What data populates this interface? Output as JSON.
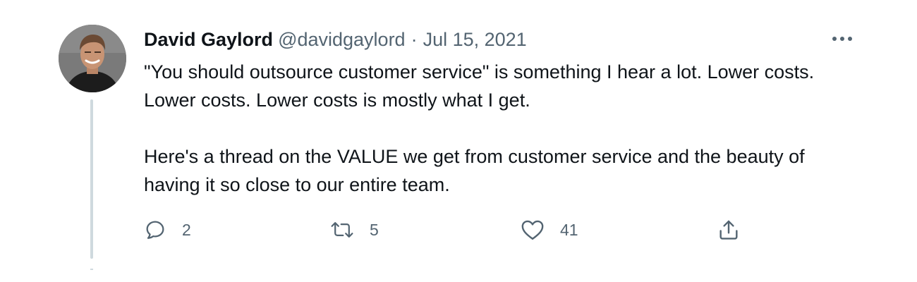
{
  "tweet": {
    "author_name": "David Gaylord",
    "author_handle": "@davidgaylord",
    "separator": "·",
    "timestamp": "Jul 15, 2021",
    "paragraphs": [
      "\"You should outsource customer service\" is something I hear a lot. Lower costs. Lower costs. Lower costs is mostly what I get.",
      "Here's a thread on the VALUE we get from customer service and the beauty of having it so close to our entire team."
    ],
    "actions": {
      "reply": {
        "icon": "reply-icon",
        "count": "2"
      },
      "retweet": {
        "icon": "retweet-icon",
        "count": "5"
      },
      "like": {
        "icon": "heart-icon",
        "count": "41"
      },
      "share": {
        "icon": "share-icon"
      }
    },
    "more_icon": "more-options-icon"
  },
  "colors": {
    "text_primary": "#0f1419",
    "text_secondary": "#536471",
    "thread_line": "#cfd9de",
    "background": "#ffffff"
  }
}
